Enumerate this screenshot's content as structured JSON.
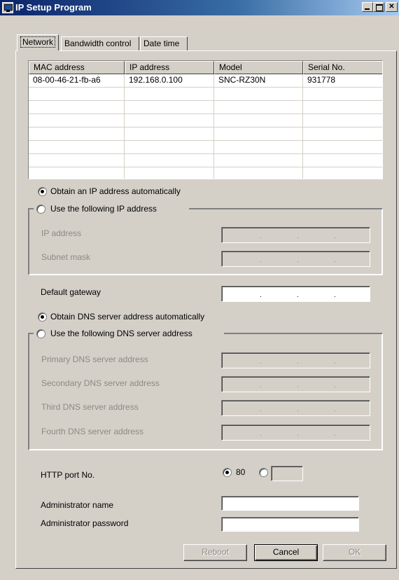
{
  "window": {
    "title": "IP Setup Program"
  },
  "tabs": [
    {
      "label": "Network"
    },
    {
      "label": "Bandwidth control"
    },
    {
      "label": "Date time"
    }
  ],
  "device_list": {
    "columns": [
      "MAC address",
      "IP address",
      "Model",
      "Serial No."
    ],
    "rows": [
      [
        "08-00-46-21-fb-a6",
        "192.168.0.100",
        "SNC-RZ30N",
        "931778"
      ]
    ]
  },
  "ip_settings": {
    "obtain_auto_label": "Obtain an IP address automatically",
    "obtain_auto_selected": true,
    "use_following_label": "Use the following IP address",
    "ip_address_label": "IP address",
    "subnet_mask_label": "Subnet mask",
    "default_gateway_label": "Default gateway"
  },
  "dns_settings": {
    "obtain_auto_label": "Obtain DNS server address automatically",
    "obtain_auto_selected": true,
    "use_following_label": "Use the following DNS server address",
    "primary_label": "Primary DNS server address",
    "secondary_label": "Secondary DNS server address",
    "third_label": "Third DNS server address",
    "fourth_label": "Fourth DNS server address"
  },
  "http": {
    "label": "HTTP port No.",
    "option_80_label": "80",
    "selected": "80",
    "custom_value": ""
  },
  "admin": {
    "name_label": "Administrator name",
    "name_value": "",
    "password_label": "Administrator password",
    "password_value": ""
  },
  "buttons": {
    "reboot": "Reboot",
    "cancel": "Cancel",
    "ok": "OK"
  },
  "ip_separator": "."
}
